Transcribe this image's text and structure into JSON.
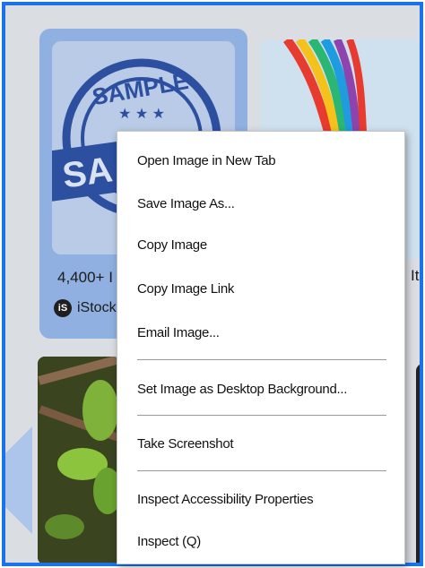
{
  "results": {
    "card1": {
      "title": "4,400+ I",
      "source_icon": "iS",
      "source": "iStock"
    },
    "card2": {
      "title_fragment": "It"
    }
  },
  "context_menu": {
    "items": [
      "Open Image in New Tab",
      "Save Image As...",
      "Copy Image",
      "Copy Image Link",
      "Email Image...",
      "Set Image as Desktop Background...",
      "Take Screenshot",
      "Inspect Accessibility Properties",
      "Inspect (Q)"
    ]
  },
  "colors": {
    "frame": "#1a73e8",
    "card_selected": "#8fb0e0",
    "stamp_blue": "#2d4fa0"
  }
}
